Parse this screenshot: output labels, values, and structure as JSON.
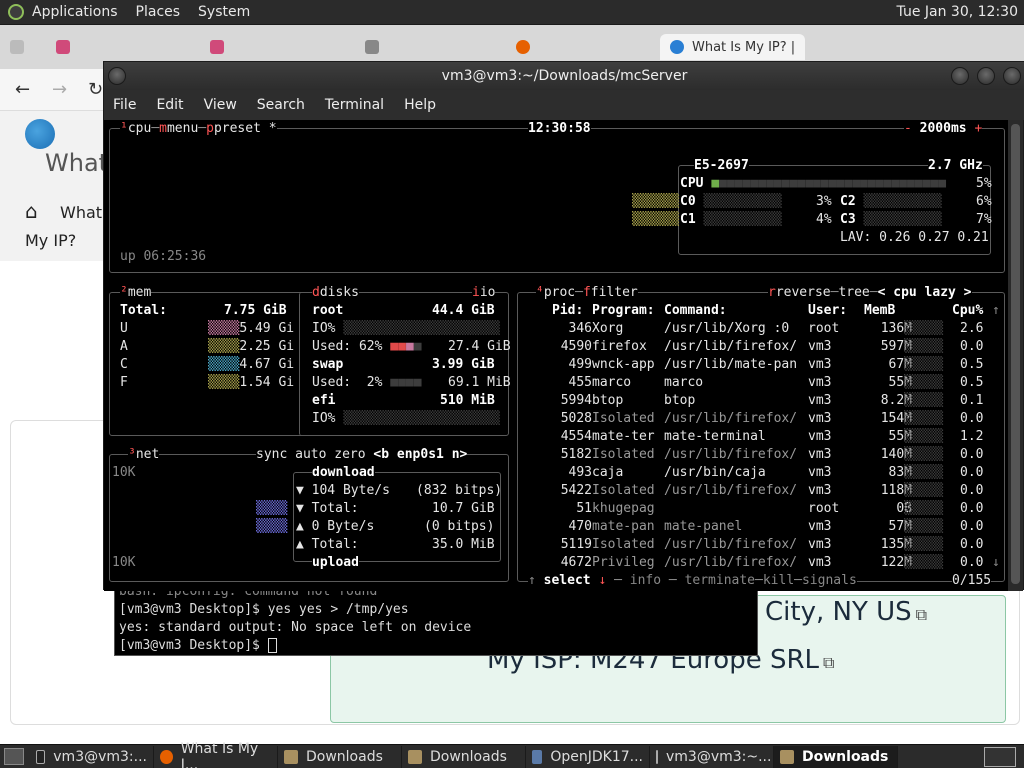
{
  "top_panel": {
    "menus": [
      "Applications",
      "Places",
      "System"
    ],
    "clock": "Tue Jan 30, 12:30"
  },
  "browser": {
    "tabs": [
      {
        "label": "",
        "icon": "app-icon",
        "color": "#d04a7a"
      },
      {
        "label": "",
        "icon": "app-icon",
        "color": "#d04a7a"
      },
      {
        "label": "",
        "icon": "speaker-icon",
        "color": "#888888"
      },
      {
        "label": "",
        "icon": "firefox-icon",
        "color": "#e66000"
      },
      {
        "label": "What Is My IP? |",
        "icon": "globe-icon",
        "color": "#2a7fd4"
      }
    ],
    "page": {
      "title": "What",
      "breadcrumb_home": "What",
      "breadcrumb_line2": "My IP?",
      "city": "City, NY US",
      "isp": "My ISP:  M247 Europe SRL"
    }
  },
  "back_terminal": {
    "line0": "bash: ipconfig: command not found",
    "line1": "[vm3@vm3 Desktop]$ yes yes > /tmp/yes",
    "line2": "yes: standard output: No space left on device",
    "line3": "[vm3@vm3 Desktop]$ "
  },
  "terminal": {
    "title": "vm3@vm3:~/Downloads/mcServer",
    "menu": [
      "File",
      "Edit",
      "View",
      "Search",
      "Terminal",
      "Help"
    ]
  },
  "btop": {
    "header": {
      "cpu_label": "cpu",
      "menu_label": "menu",
      "preset_label": "preset",
      "star": "*",
      "time": "12:30:58",
      "interval": "2000ms",
      "minus": "-",
      "plus": "+",
      "uptime": "up 06:25:36"
    },
    "cpu_box": {
      "model": "E5-2697",
      "freq": "2.7 GHz",
      "total_label": "CPU",
      "total_pct": "5%",
      "cores": [
        {
          "label": "C0",
          "pct": "3%"
        },
        {
          "label": "C1",
          "pct": "4%"
        },
        {
          "label": "C2",
          "pct": "6%"
        },
        {
          "label": "C3",
          "pct": "7%"
        }
      ],
      "lav": "LAV: 0.26 0.27 0.21"
    },
    "mem": {
      "title": "mem",
      "total_label": "Total:",
      "total": "7.75 GiB",
      "rows": [
        {
          "label": "U",
          "value": "5.49 Gi"
        },
        {
          "label": "A",
          "value": "2.25 Gi"
        },
        {
          "label": "C",
          "value": "4.67 Gi"
        },
        {
          "label": "F",
          "value": "1.54 Gi"
        }
      ]
    },
    "disks": {
      "title": "disks",
      "io": "io",
      "root_label": "root",
      "root_size": "44.4 GiB",
      "root_io": "IO%",
      "root_used_label": "Used: 62%",
      "root_used": "27.4 GiB",
      "swap_label": "swap",
      "swap_size": "3.99 GiB",
      "swap_used_label": "Used:  2%",
      "swap_used": "69.1 MiB",
      "efi_label": "efi",
      "efi_size": "510 MiB",
      "efi_io": "IO%"
    },
    "net": {
      "title": "net",
      "sync": "sync",
      "auto": "auto",
      "zero": "zero",
      "iface": "<b enp0s1 n>",
      "scale_top": "10K",
      "scale_bottom": "10K",
      "download": "download",
      "down_rate": "104 Byte/s",
      "down_bits": "(832 bitps)",
      "down_total_label": "Total:",
      "down_total": "10.7 GiB",
      "up_rate": "0 Byte/s",
      "up_bits": "(0 bitps)",
      "up_total_label": "Total:",
      "up_total": "35.0 MiB",
      "upload": "upload"
    },
    "proc": {
      "title": "proc",
      "filter": "filter",
      "reverse": "reverse",
      "tree": "tree",
      "sort": "< cpu lazy >",
      "headers": [
        "Pid:",
        "Program:",
        "Command:",
        "User:",
        "MemB",
        "Cpu%"
      ],
      "rows": [
        {
          "pid": "346",
          "prog": "Xorg",
          "cmd": "/usr/lib/Xorg :0",
          "user": "root",
          "mem": "136M",
          "cpu": "2.6"
        },
        {
          "pid": "4590",
          "prog": "firefox",
          "cmd": "/usr/lib/firefox/",
          "user": "vm3",
          "mem": "597M",
          "cpu": "0.0"
        },
        {
          "pid": "499",
          "prog": "wnck-app",
          "cmd": "/usr/lib/mate-pan",
          "user": "vm3",
          "mem": "67M",
          "cpu": "0.5"
        },
        {
          "pid": "455",
          "prog": "marco",
          "cmd": "marco",
          "user": "vm3",
          "mem": "55M",
          "cpu": "0.5"
        },
        {
          "pid": "5994",
          "prog": "btop",
          "cmd": "btop",
          "user": "vm3",
          "mem": "8.2M",
          "cpu": "0.1"
        },
        {
          "pid": "5028",
          "prog": "Isolated",
          "cmd": "/usr/lib/firefox/",
          "user": "vm3",
          "mem": "154M",
          "cpu": "0.0"
        },
        {
          "pid": "4554",
          "prog": "mate-ter",
          "cmd": "mate-terminal",
          "user": "vm3",
          "mem": "55M",
          "cpu": "1.2"
        },
        {
          "pid": "5182",
          "prog": "Isolated",
          "cmd": "/usr/lib/firefox/",
          "user": "vm3",
          "mem": "140M",
          "cpu": "0.0"
        },
        {
          "pid": "493",
          "prog": "caja",
          "cmd": "/usr/bin/caja",
          "user": "vm3",
          "mem": "83M",
          "cpu": "0.0"
        },
        {
          "pid": "5422",
          "prog": "Isolated",
          "cmd": "/usr/lib/firefox/",
          "user": "vm3",
          "mem": "118M",
          "cpu": "0.0"
        },
        {
          "pid": "51",
          "prog": "khugepag",
          "cmd": "",
          "user": "root",
          "mem": "0B",
          "cpu": "0.0"
        },
        {
          "pid": "470",
          "prog": "mate-pan",
          "cmd": "mate-panel",
          "user": "vm3",
          "mem": "57M",
          "cpu": "0.0"
        },
        {
          "pid": "5119",
          "prog": "Isolated",
          "cmd": "/usr/lib/firefox/",
          "user": "vm3",
          "mem": "135M",
          "cpu": "0.0"
        },
        {
          "pid": "4672",
          "prog": "Privileg",
          "cmd": "/usr/lib/firefox/",
          "user": "vm3",
          "mem": "122M",
          "cpu": "0.0"
        }
      ],
      "footer_select": "select",
      "footer_info": "info",
      "footer_terminate": "terminate",
      "footer_kill": "kill",
      "footer_signals": "signals",
      "footer_count": "0/155"
    }
  },
  "taskbar": {
    "items": [
      {
        "label": "vm3@vm3:...",
        "icon": "terminal-icon",
        "active": false
      },
      {
        "label": "What Is My I...",
        "icon": "firefox-icon",
        "active": false
      },
      {
        "label": "Downloads",
        "icon": "folder-icon",
        "active": false
      },
      {
        "label": "Downloads",
        "icon": "folder-icon",
        "active": false
      },
      {
        "label": "OpenJDK17...",
        "icon": "java-icon",
        "active": false
      },
      {
        "label": "vm3@vm3:~...",
        "icon": "terminal-icon",
        "active": false
      },
      {
        "label": "Downloads",
        "icon": "folder-icon",
        "active": true
      }
    ]
  }
}
